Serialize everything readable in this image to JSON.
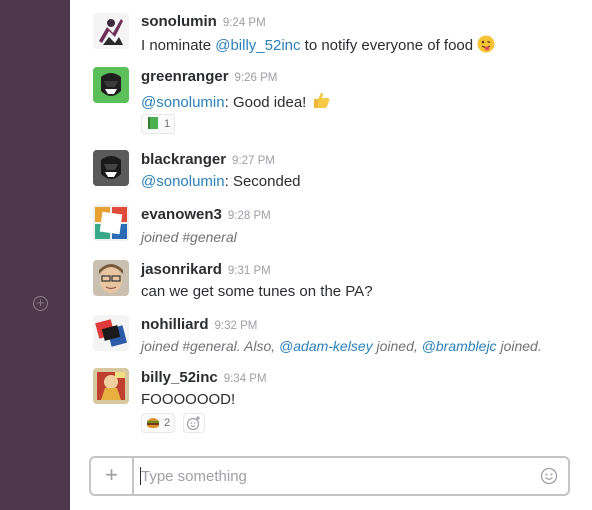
{
  "messages": [
    {
      "user": "sonolumin",
      "time": "9:24 PM",
      "parts": [
        {
          "text": "I nominate ",
          "mention": false
        },
        {
          "text": "@billy_52inc",
          "mention": true
        },
        {
          "text": " to notify everyone of food ",
          "mention": false
        }
      ],
      "emoji": "winking-tongue-face-emoji"
    },
    {
      "user": "greenranger",
      "time": "9:26 PM",
      "parts": [
        {
          "text": "@sonolumin",
          "mention": true
        },
        {
          "text": ": Good idea! ",
          "mention": false
        }
      ],
      "emoji": "thumbs-up-emoji",
      "reaction": {
        "icon": "green-book-emoji",
        "count": "1"
      }
    },
    {
      "user": "blackranger",
      "time": "9:27 PM",
      "parts": [
        {
          "text": "@sonolumin",
          "mention": true
        },
        {
          "text": ": Seconded",
          "mention": false
        }
      ]
    },
    {
      "user": "evanowen3",
      "time": "9:28 PM",
      "system": true,
      "parts": [
        {
          "text": "joined #general",
          "mention": false
        }
      ]
    },
    {
      "user": "jasonrikard",
      "time": "9:31 PM",
      "parts": [
        {
          "text": "can we get some tunes on the PA?",
          "mention": false
        }
      ]
    },
    {
      "user": "nohilliard",
      "time": "9:32 PM",
      "system": true,
      "parts": [
        {
          "text": "joined #general. Also, ",
          "mention": false
        },
        {
          "text": "@adam-kelsey",
          "mention": true
        },
        {
          "text": " joined, ",
          "mention": false
        },
        {
          "text": "@bramblejc",
          "mention": true
        },
        {
          "text": " joined.",
          "mention": false
        }
      ]
    },
    {
      "user": "billy_52inc",
      "time": "9:34 PM",
      "parts": [
        {
          "text": "FOOOOOOD!",
          "mention": false
        }
      ],
      "reaction": {
        "icon": "hamburger-emoji",
        "count": "2"
      }
    }
  ],
  "composer": {
    "plus": "+",
    "placeholder": "Type something"
  },
  "sidebar": {
    "add": "+"
  },
  "colors": {
    "sidebar": "#4d394b",
    "mention": "#2a80b9",
    "timestamp": "#9e9ea6"
  }
}
